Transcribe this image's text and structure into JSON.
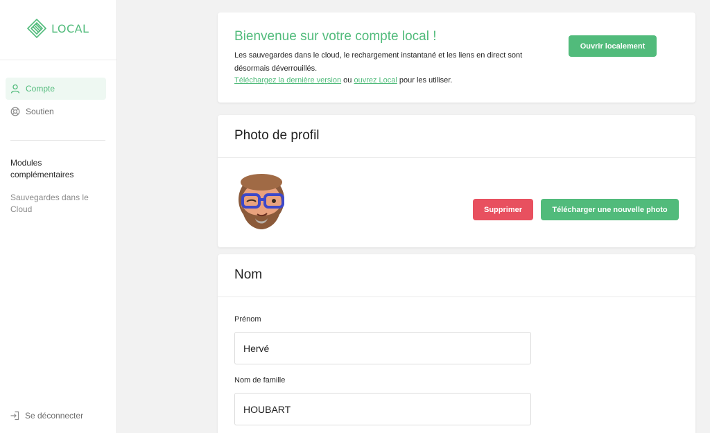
{
  "app": {
    "logo_text": "LOCAL",
    "accent": "#51bb7b",
    "danger": "#e8505f"
  },
  "sidebar": {
    "items": [
      {
        "label": "Compte",
        "icon": "user-icon",
        "active": true
      },
      {
        "label": "Soutien",
        "icon": "lifebuoy-icon",
        "active": false
      }
    ],
    "modules_title": "Modules complémentaires",
    "modules_items": [
      {
        "label": "Sauvegardes dans le Cloud"
      }
    ],
    "logout_label": "Se déconnecter"
  },
  "welcome": {
    "title": "Bienvenue sur votre compte local !",
    "text": "Les sauvegardes dans le cloud, le rechargement instantané et les liens en direct sont désormais déverrouillés.",
    "download_link": "Téléchargez la dernière version",
    "or_text": " ou ",
    "open_link": "ouvrez Local",
    "suffix_text": " pour les utiliser.",
    "open_button": "Ouvrir localement"
  },
  "profile": {
    "title": "Photo de profil",
    "delete_button": "Supprimer",
    "upload_button": "Télécharger une nouvelle photo"
  },
  "name_section": {
    "title": "Nom",
    "first_name_label": "Prénom",
    "first_name_value": "Hervé",
    "last_name_label": "Nom de famille",
    "last_name_value": "HOUBART"
  }
}
